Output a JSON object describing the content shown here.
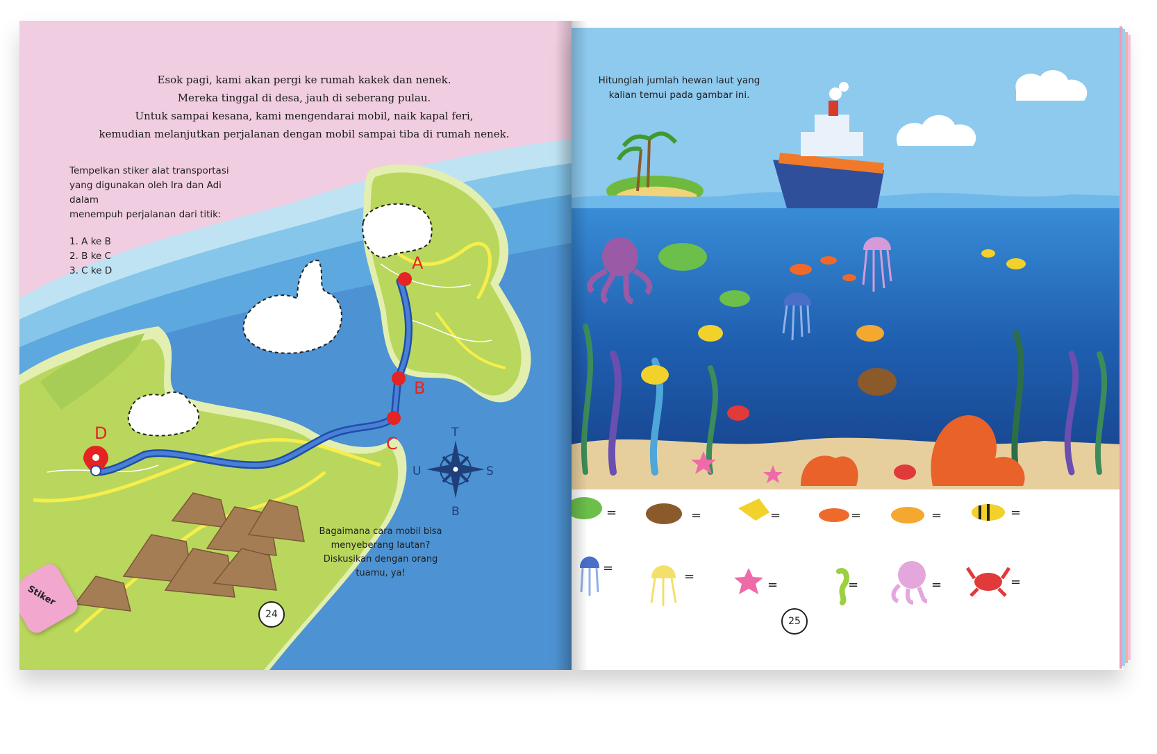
{
  "left_page": {
    "story_lines": [
      "Esok pagi, kami akan pergi ke rumah kakek dan nenek.",
      "Mereka tinggal di desa, jauh di seberang pulau.",
      "Untuk sampai kesana, kami mengendarai mobil, naik kapal feri,",
      "kemudian melanjutkan perjalanan dengan mobil sampai tiba di rumah nenek."
    ],
    "instruction_lines": [
      "Tempelkan stiker alat transportasi",
      "yang digunakan oleh Ira dan Adi dalam",
      "menempuh perjalanan dari titik:"
    ],
    "steps": [
      "1. A ke B",
      "2. B ke C",
      "3. C ke D"
    ],
    "points": [
      "A",
      "B",
      "C",
      "D"
    ],
    "compass": {
      "north": "T",
      "south": "B",
      "west": "U",
      "east": "S"
    },
    "question_lines": [
      "Bagaimana cara mobil bisa",
      "menyeberang lautan?",
      "Diskusikan dengan orang",
      "tuamu, ya!"
    ],
    "sticker_tab": "Stiker",
    "page_number": "24"
  },
  "right_page": {
    "instruction_lines": [
      "Hitunglah jumlah hewan laut yang",
      "kalian temui pada gambar ini."
    ],
    "count_items_row1": [
      "sea-turtle",
      "tortoise",
      "angelfish",
      "clownfish",
      "lionfish",
      "yellow-striped-fish"
    ],
    "count_items_row2": [
      "blue-jellyfish",
      "yellow-jellyfish",
      "starfish",
      "seahorse",
      "octopus",
      "crab"
    ],
    "equals_sign": "=",
    "page_number": "25"
  },
  "colors": {
    "pink_sky": "#f0cde0",
    "sea_blue": "#4f8fd0",
    "land_green": "#b7d45a",
    "route_blue": "#2a5fb8",
    "marker_red": "#e52323",
    "ocean_deep": "#1f5fb0",
    "sky_blue": "#8ec9ee"
  }
}
